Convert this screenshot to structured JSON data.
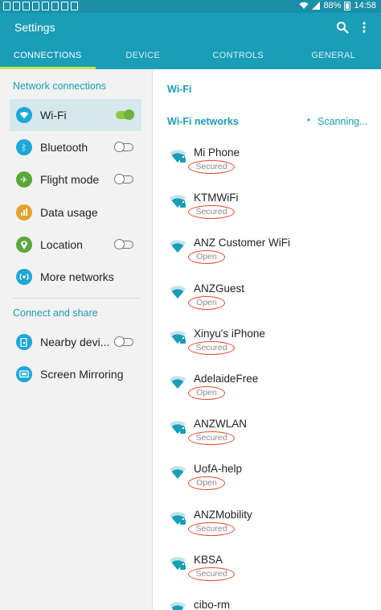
{
  "status_bar": {
    "battery": "88%",
    "time": "14:58"
  },
  "header": {
    "title": "Settings",
    "search_icon": "search-icon",
    "more_icon": "more-vert-icon"
  },
  "tabs": [
    {
      "label": "CONNECTIONS",
      "active": true
    },
    {
      "label": "DEVICE",
      "active": false
    },
    {
      "label": "CONTROLS",
      "active": false
    },
    {
      "label": "GENERAL",
      "active": false
    }
  ],
  "sidebar": {
    "section1": "Network connections",
    "section2": "Connect and share",
    "items": [
      {
        "label": "Wi-Fi",
        "icon": "wifi-icon",
        "color": "#1aa8d8",
        "toggle": "on"
      },
      {
        "label": "Bluetooth",
        "icon": "bluetooth-icon",
        "color": "#1aa8d8",
        "toggle": "off"
      },
      {
        "label": "Flight mode",
        "icon": "airplane-icon",
        "color": "#5aa83a",
        "toggle": "off"
      },
      {
        "label": "Data usage",
        "icon": "data-usage-icon",
        "color": "#e5a32a"
      },
      {
        "label": "Location",
        "icon": "location-icon",
        "color": "#5aa83a",
        "toggle": "off"
      },
      {
        "label": "More networks",
        "icon": "more-networks-icon",
        "color": "#1aa8d8"
      },
      {
        "label": "Nearby devi...",
        "icon": "nearby-devices-icon",
        "color": "#1aa8d8",
        "toggle": "off"
      },
      {
        "label": "Screen Mirroring",
        "icon": "screen-mirroring-icon",
        "color": "#1aa8d8"
      }
    ]
  },
  "main": {
    "title": "Wi-Fi",
    "subtitle": "Wi-Fi networks",
    "scanning": "Scanning...",
    "networks": [
      {
        "name": "Mi Phone",
        "status": "Secured",
        "locked": true
      },
      {
        "name": "KTMWiFi",
        "status": "Secured",
        "locked": true
      },
      {
        "name": "ANZ Customer WiFi",
        "status": "Open",
        "locked": false
      },
      {
        "name": "ANZGuest",
        "status": "Open",
        "locked": false
      },
      {
        "name": "Xinyu's iPhone",
        "status": "Secured",
        "locked": true
      },
      {
        "name": "AdelaideFree",
        "status": "Open",
        "locked": false
      },
      {
        "name": "ANZWLAN",
        "status": "Secured",
        "locked": true
      },
      {
        "name": "UofA-help",
        "status": "Open",
        "locked": false
      },
      {
        "name": "ANZMobility",
        "status": "Secured",
        "locked": true
      },
      {
        "name": "KBSA",
        "status": "Secured",
        "locked": true
      },
      {
        "name": "cibo-rm",
        "status": "",
        "locked": false
      }
    ]
  },
  "colors": {
    "accent": "#1a9db6",
    "highlight_circle": "#e04a2c",
    "toggle_on": "#69b43a"
  }
}
